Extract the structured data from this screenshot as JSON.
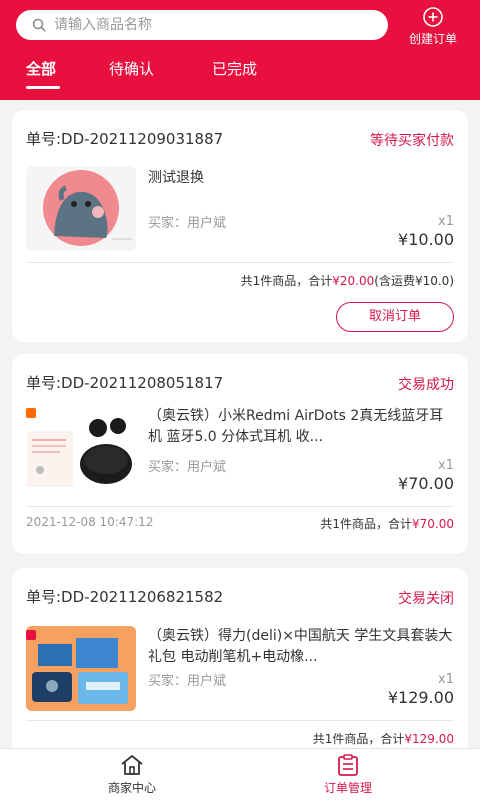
{
  "search": {
    "placeholder": "请输入商品名称"
  },
  "header": {
    "create_label": "创建订单"
  },
  "tabs": [
    {
      "label": "全部",
      "active": true
    },
    {
      "label": "待确认",
      "active": false
    },
    {
      "label": "已完成",
      "active": false
    }
  ],
  "orders": [
    {
      "order_no": "单号:DD-20211209031887",
      "status": "等待买家付款",
      "title": "测试退换",
      "buyer": "买家：用户斌",
      "qty": "x1",
      "price": "¥10.00",
      "summary_prefix": "共1件商品，合计",
      "summary_amount": "¥20.00",
      "summary_suffix": "(含运费¥10.0)",
      "action": "取消订单"
    },
    {
      "order_no": "单号:DD-20211208051817",
      "status": "交易成功",
      "title": "（奥云铁）小米Redmi AirDots 2真无线蓝牙耳机 蓝牙5.0 分体式耳机 收...",
      "buyer": "买家：用户斌",
      "qty": "x1",
      "price": "¥70.00",
      "time": "2021-12-08 10:47:12",
      "summary_prefix": "共1件商品，合计",
      "summary_amount": "¥70.00"
    },
    {
      "order_no": "单号:DD-20211206821582",
      "status": "交易关闭",
      "title": "（奥云铁）得力(deli)×中国航天 学生文具套装大礼包 电动削笔机+电动橡...",
      "buyer": "买家：用户斌",
      "qty": "x1",
      "price": "¥129.00",
      "summary_prefix": "共1件商品，合计",
      "summary_amount": "¥129.00"
    }
  ],
  "bottom_nav": [
    {
      "label": "商家中心",
      "icon": "home-icon",
      "active": false
    },
    {
      "label": "订单管理",
      "icon": "order-list-icon",
      "active": true
    }
  ],
  "colors": {
    "brand": "#e8103f",
    "accent": "#d6194a",
    "muted": "#999999"
  }
}
